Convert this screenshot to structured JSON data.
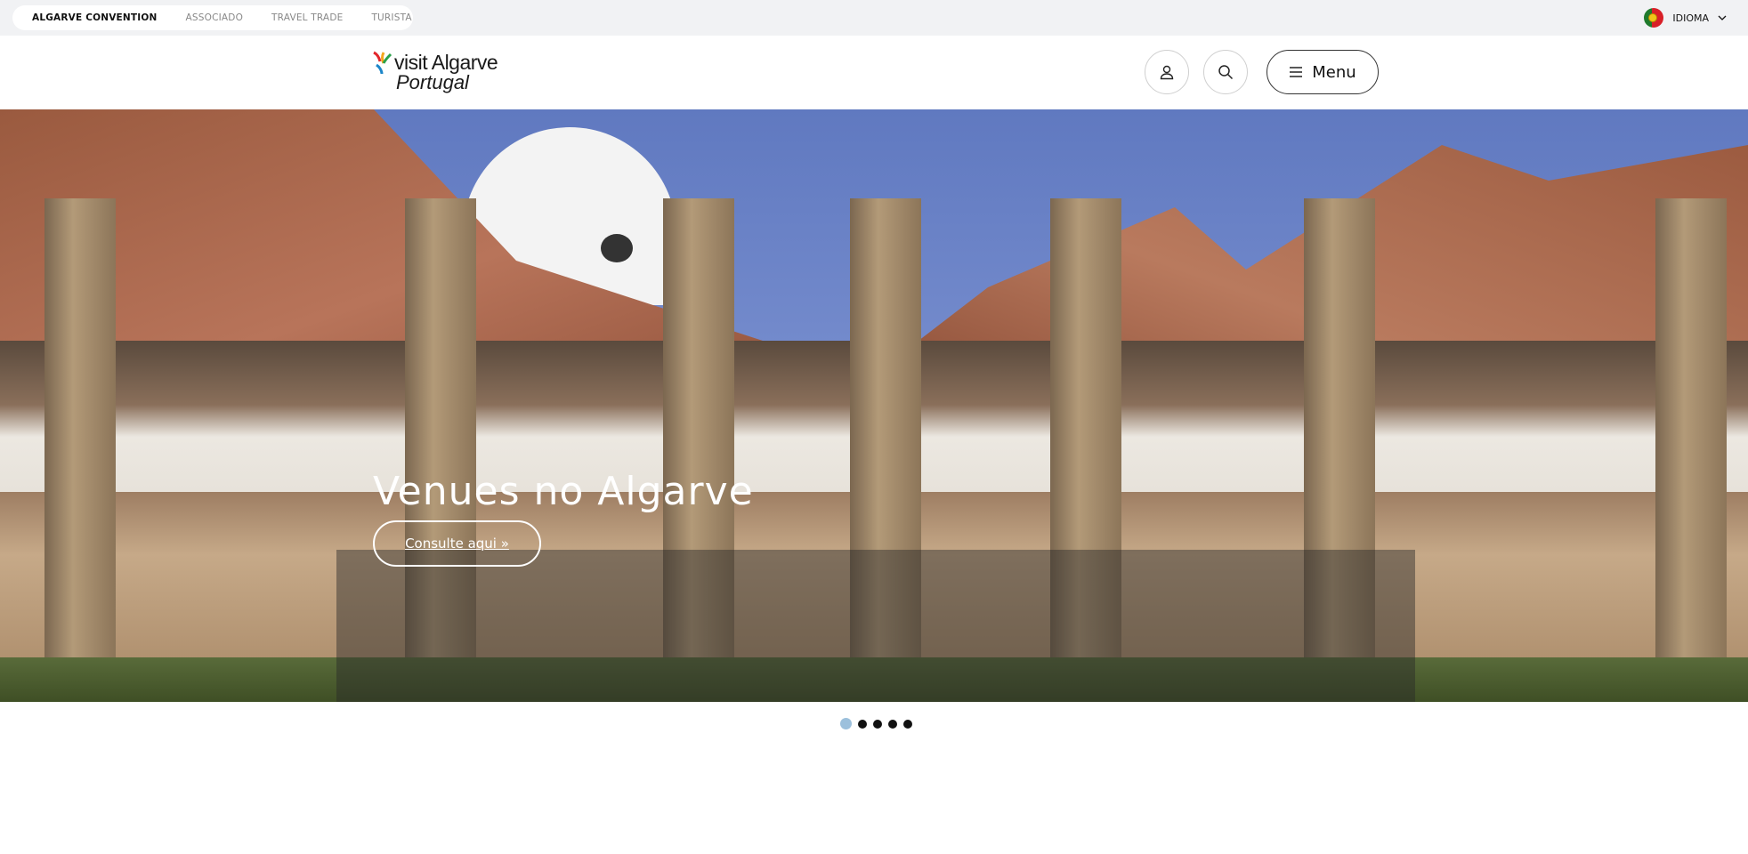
{
  "topbar": {
    "audience_links": [
      {
        "label": "ALGARVE CONVENTION",
        "active": true
      },
      {
        "label": "ASSOCIADO",
        "active": false
      },
      {
        "label": "TRAVEL TRADE",
        "active": false
      },
      {
        "label": "TURISTA",
        "active": false
      }
    ],
    "language_label": "IDIOMA"
  },
  "header": {
    "logo_line1": "visit Algarve",
    "logo_line2": "Portugal",
    "menu_label": "Menu",
    "icons": [
      "user-icon",
      "search-icon",
      "hamburger-icon"
    ]
  },
  "hero": {
    "title": "Venues no Algarve",
    "cta_label": "Consulte aqui »"
  },
  "carousel": {
    "slide_count": 5,
    "active_index": 0
  },
  "colors": {
    "topbar_bg": "#f1f2f4",
    "active_dot": "#9cc0dc"
  }
}
